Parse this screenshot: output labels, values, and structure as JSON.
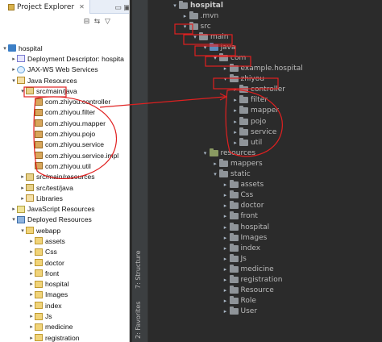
{
  "left_panel": {
    "tab_title": "Project Explorer",
    "toolbar": [
      "collapse-all-icon",
      "link-editor-icon",
      "view-menu-icon",
      "minimize-icon",
      "maximize-icon"
    ],
    "tree": [
      {
        "depth": 0,
        "expanded": true,
        "icon": "project-icon",
        "label": "hospital"
      },
      {
        "depth": 1,
        "expanded": false,
        "icon": "descriptor-icon",
        "label": "Deployment Descriptor: hospita"
      },
      {
        "depth": 1,
        "expanded": false,
        "icon": "webservice-icon",
        "label": "JAX-WS Web Services"
      },
      {
        "depth": 1,
        "expanded": true,
        "icon": "library-icon",
        "label": "Java Resources"
      },
      {
        "depth": 2,
        "expanded": true,
        "icon": "source-folder-icon",
        "label": "src/main/java"
      },
      {
        "depth": 3,
        "expanded": null,
        "icon": "package-icon",
        "label": "com.zhiyou.controller"
      },
      {
        "depth": 3,
        "expanded": null,
        "icon": "package-icon",
        "label": "com.zhiyou.filter"
      },
      {
        "depth": 3,
        "expanded": null,
        "icon": "package-icon",
        "label": "com.zhiyou.mapper"
      },
      {
        "depth": 3,
        "expanded": null,
        "icon": "package-icon",
        "label": "com.zhiyou.pojo"
      },
      {
        "depth": 3,
        "expanded": null,
        "icon": "package-icon",
        "label": "com.zhiyou.service"
      },
      {
        "depth": 3,
        "expanded": null,
        "icon": "package-icon",
        "label": "com.zhiyou.service.impl"
      },
      {
        "depth": 3,
        "expanded": null,
        "icon": "package-icon",
        "label": "com.zhiyou.util"
      },
      {
        "depth": 2,
        "expanded": false,
        "icon": "source-folder-icon",
        "label": "src/main/resources"
      },
      {
        "depth": 2,
        "expanded": false,
        "icon": "source-folder-icon",
        "label": "src/test/java"
      },
      {
        "depth": 2,
        "expanded": false,
        "icon": "library-icon",
        "label": "Libraries"
      },
      {
        "depth": 1,
        "expanded": false,
        "icon": "js-resources-icon",
        "label": "JavaScript Resources"
      },
      {
        "depth": 1,
        "expanded": true,
        "icon": "deployed-icon",
        "label": "Deployed Resources"
      },
      {
        "depth": 2,
        "expanded": true,
        "icon": "folder-icon",
        "label": "webapp"
      },
      {
        "depth": 3,
        "expanded": false,
        "icon": "folder-icon",
        "label": "assets"
      },
      {
        "depth": 3,
        "expanded": false,
        "icon": "folder-icon",
        "label": "Css"
      },
      {
        "depth": 3,
        "expanded": false,
        "icon": "folder-icon",
        "label": "doctor"
      },
      {
        "depth": 3,
        "expanded": false,
        "icon": "folder-icon",
        "label": "front"
      },
      {
        "depth": 3,
        "expanded": false,
        "icon": "folder-icon",
        "label": "hospital"
      },
      {
        "depth": 3,
        "expanded": false,
        "icon": "folder-icon",
        "label": "Images"
      },
      {
        "depth": 3,
        "expanded": false,
        "icon": "folder-icon",
        "label": "index"
      },
      {
        "depth": 3,
        "expanded": false,
        "icon": "folder-icon",
        "label": "Js"
      },
      {
        "depth": 3,
        "expanded": false,
        "icon": "folder-icon",
        "label": "medicine"
      },
      {
        "depth": 3,
        "expanded": false,
        "icon": "folder-icon",
        "label": "registration"
      }
    ]
  },
  "right_panel": {
    "side_tabs": [
      "7: Structure",
      "2: Favorites"
    ],
    "tree": [
      {
        "depth": 0,
        "expanded": true,
        "kind": "folder",
        "label": "hospital",
        "bold": true
      },
      {
        "depth": 1,
        "expanded": false,
        "kind": "folder",
        "label": ".mvn"
      },
      {
        "depth": 1,
        "expanded": true,
        "kind": "folder",
        "label": "src"
      },
      {
        "depth": 2,
        "expanded": true,
        "kind": "folder",
        "label": "main"
      },
      {
        "depth": 3,
        "expanded": true,
        "kind": "source",
        "label": "java"
      },
      {
        "depth": 4,
        "expanded": true,
        "kind": "package",
        "label": "com"
      },
      {
        "depth": 5,
        "expanded": false,
        "kind": "package",
        "label": "example.hospital"
      },
      {
        "depth": 5,
        "expanded": true,
        "kind": "package",
        "label": "zhiyou"
      },
      {
        "depth": 6,
        "expanded": false,
        "kind": "package",
        "label": "controller"
      },
      {
        "depth": 6,
        "expanded": false,
        "kind": "package",
        "label": "filter"
      },
      {
        "depth": 6,
        "expanded": false,
        "kind": "package",
        "label": "mapper"
      },
      {
        "depth": 6,
        "expanded": false,
        "kind": "package",
        "label": "pojo"
      },
      {
        "depth": 6,
        "expanded": false,
        "kind": "package",
        "label": "service"
      },
      {
        "depth": 6,
        "expanded": false,
        "kind": "package",
        "label": "util"
      },
      {
        "depth": 3,
        "expanded": true,
        "kind": "resource",
        "label": "resources"
      },
      {
        "depth": 4,
        "expanded": false,
        "kind": "folder",
        "label": "mappers"
      },
      {
        "depth": 4,
        "expanded": true,
        "kind": "folder",
        "label": "static"
      },
      {
        "depth": 5,
        "expanded": false,
        "kind": "folder",
        "label": "assets"
      },
      {
        "depth": 5,
        "expanded": false,
        "kind": "folder",
        "label": "Css"
      },
      {
        "depth": 5,
        "expanded": false,
        "kind": "folder",
        "label": "doctor"
      },
      {
        "depth": 5,
        "expanded": false,
        "kind": "folder",
        "label": "front"
      },
      {
        "depth": 5,
        "expanded": false,
        "kind": "folder",
        "label": "hospital"
      },
      {
        "depth": 5,
        "expanded": false,
        "kind": "folder",
        "label": "Images"
      },
      {
        "depth": 5,
        "expanded": false,
        "kind": "folder",
        "label": "index"
      },
      {
        "depth": 5,
        "expanded": false,
        "kind": "folder",
        "label": "Js"
      },
      {
        "depth": 5,
        "expanded": false,
        "kind": "folder",
        "label": "medicine"
      },
      {
        "depth": 5,
        "expanded": false,
        "kind": "folder",
        "label": "registration"
      },
      {
        "depth": 5,
        "expanded": false,
        "kind": "folder",
        "label": "Resource"
      },
      {
        "depth": 5,
        "expanded": false,
        "kind": "folder",
        "label": "Role"
      },
      {
        "depth": 5,
        "expanded": false,
        "kind": "folder",
        "label": "User"
      }
    ]
  },
  "annotation_color": "#e02020"
}
